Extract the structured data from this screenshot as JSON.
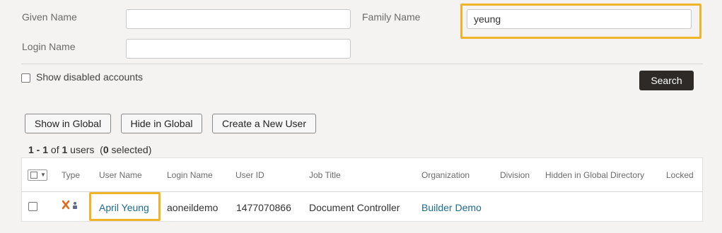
{
  "filters": {
    "given_name": {
      "label": "Given Name",
      "value": ""
    },
    "family_name": {
      "label": "Family Name",
      "value": "yeung"
    },
    "login_name": {
      "label": "Login Name",
      "value": ""
    },
    "show_disabled": {
      "label": "Show disabled accounts",
      "checked": false
    },
    "search_label": "Search"
  },
  "actions": {
    "show_global": "Show in Global",
    "hide_global": "Hide in Global",
    "create_user": "Create a New User"
  },
  "summary": {
    "range": "1 - 1",
    "of": " of ",
    "total": "1",
    "users": " users  (",
    "selected": "0",
    "selected_suffix": " selected)"
  },
  "table": {
    "columns": [
      "Type",
      "User Name",
      "Login Name",
      "User ID",
      "Job Title",
      "Organization",
      "Division",
      "Hidden in Global Directory",
      "Locked"
    ],
    "rows": [
      {
        "type_icon": "external-user-icon",
        "user_name": "April Yeung",
        "login_name": "aoneildemo",
        "user_id": "1477070866",
        "job_title": "Document Controller",
        "organization": "Builder Demo",
        "division": "",
        "hidden": "",
        "locked": ""
      }
    ]
  },
  "colors": {
    "highlight": "#f0b429",
    "link": "#1d6b8f",
    "search_bg": "#2e2a27"
  }
}
